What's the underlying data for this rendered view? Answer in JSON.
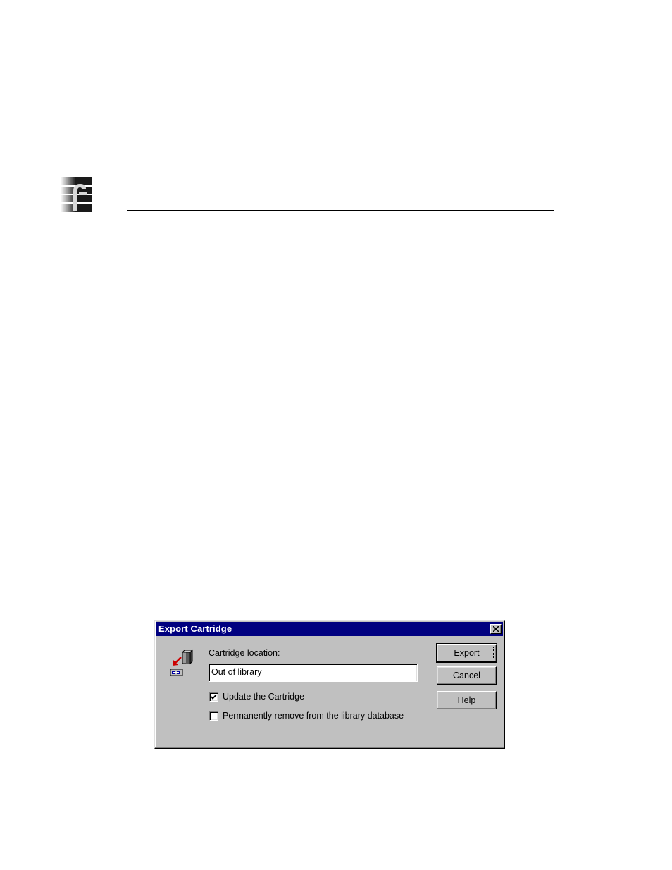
{
  "dialog": {
    "title": "Export Cartridge",
    "cartridge_location_label": "Cartridge location:",
    "cartridge_location_value": "Out of library",
    "update_cartridge_label": "Update the Cartridge",
    "update_cartridge_checked": true,
    "remove_from_db_label": "Permanently remove from the library database",
    "remove_from_db_checked": false,
    "buttons": {
      "export": "Export",
      "cancel": "Cancel",
      "help": "Help"
    }
  },
  "icons": {
    "page_logo": "brand-logo-icon",
    "close": "close-icon",
    "export": "export-cartridge-icon",
    "check": "checkmark-icon"
  },
  "colors": {
    "titlebar": "#000080",
    "dialog_face": "#c0c0c0",
    "export_arrow": "#cc0000"
  }
}
